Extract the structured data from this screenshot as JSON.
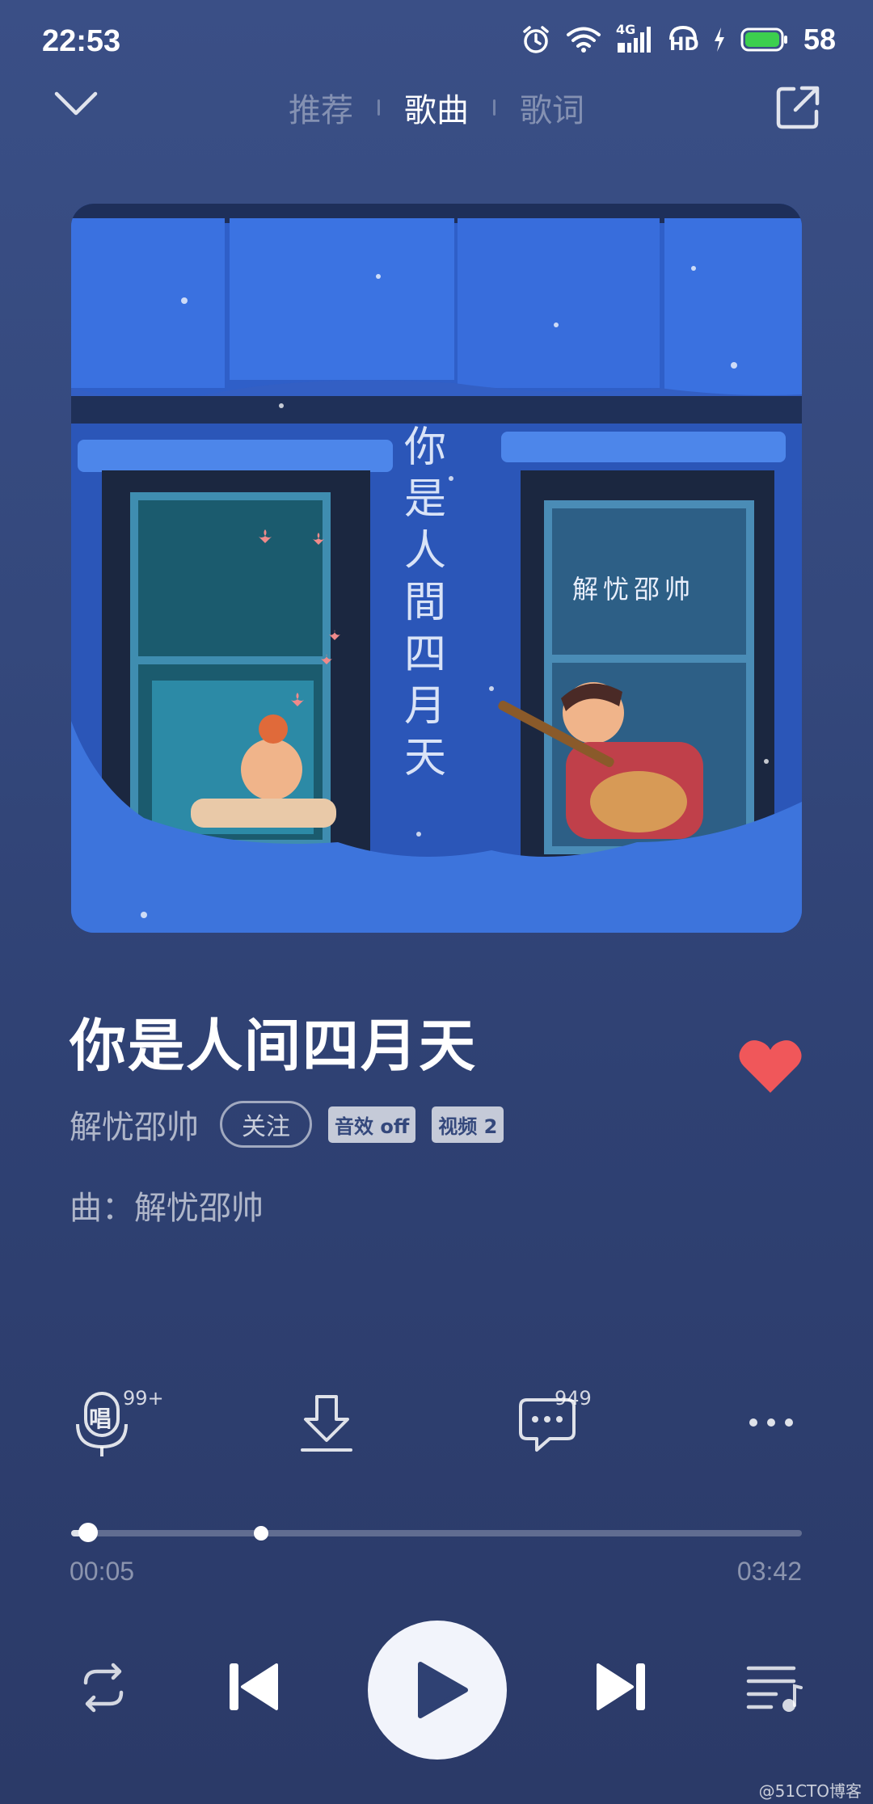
{
  "status_bar": {
    "time": "22:53",
    "signal_label": "4G",
    "hd_label": "HD",
    "battery": "58",
    "icons": [
      "alarm-icon",
      "wifi-icon",
      "cellular-signal-icon",
      "hd-voice-icon",
      "charging-icon",
      "battery-icon"
    ]
  },
  "nav": {
    "back_icon": "chevron-down-icon",
    "tabs": [
      {
        "label": "推荐",
        "active": false
      },
      {
        "label": "歌曲",
        "active": true
      },
      {
        "label": "歌词",
        "active": false
      }
    ],
    "share_icon": "share-external-icon"
  },
  "album": {
    "cover_title": "你是人間四月天",
    "cover_artist": "解忧邵帅"
  },
  "song": {
    "title": "你是人间四月天",
    "artist": "解忧邵帅",
    "follow_label": "关注",
    "tags": [
      "音效 off",
      "视频 2"
    ],
    "composer": "曲：解忧邵帅",
    "liked": true
  },
  "actions": {
    "sing": {
      "icon": "microphone-sing-icon",
      "glyph": "唱",
      "badge": "99+"
    },
    "download": {
      "icon": "download-icon"
    },
    "comment": {
      "icon": "comment-icon",
      "badge": "949"
    },
    "more": {
      "icon": "more-dots-icon"
    }
  },
  "progress": {
    "current": "00:05",
    "total": "03:42",
    "played_fraction": 0.023,
    "buffered_fraction": 0.26
  },
  "controls": {
    "repeat_icon": "repeat-icon",
    "prev_icon": "previous-track-icon",
    "play_icon": "play-icon",
    "next_icon": "next-track-icon",
    "playlist_icon": "playlist-icon"
  },
  "watermark": "@51CTO博客",
  "colors": {
    "like": "#f0575a",
    "background_top": "#3a4f86",
    "background_bottom": "#2b3a68",
    "album_blue": "#2f5fc8"
  }
}
